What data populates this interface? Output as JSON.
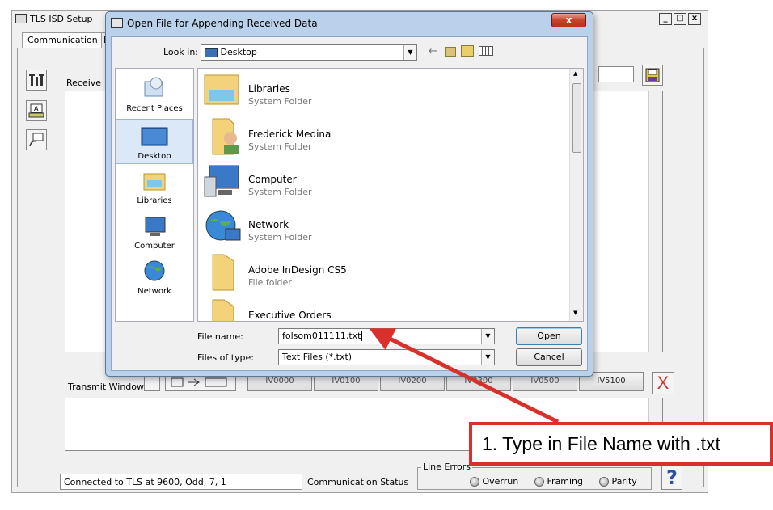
{
  "app": {
    "title": "TLS ISD Setup",
    "tab_label": "Communication",
    "tab_partial": "D",
    "received_label": "Receive",
    "transmit_label": "Transmit Window",
    "cmd_buttons": [
      "IV0000",
      "IV0100",
      "IV0200",
      "IV0300",
      "IV0500",
      "IV5100"
    ],
    "status_text": "Connected to TLS at 9600, Odd, 7, 1",
    "status_label": "Communication Status",
    "line_errors_label": "Line Errors",
    "errors": [
      "Overrun",
      "Framing",
      "Parity"
    ],
    "help_symbol": "?",
    "clear_symbol": "X",
    "minimize": "_",
    "maximize": "□",
    "close": "x"
  },
  "dialog": {
    "title": "Open File for Appending Received Data",
    "close_symbol": "x",
    "look_in_label": "Look in:",
    "look_in_value": "Desktop",
    "places": [
      "Recent Places",
      "Desktop",
      "Libraries",
      "Computer",
      "Network"
    ],
    "files": [
      {
        "name": "Libraries",
        "type": "System Folder"
      },
      {
        "name": "Frederick Medina",
        "type": "System Folder"
      },
      {
        "name": "Computer",
        "type": "System Folder"
      },
      {
        "name": "Network",
        "type": "System Folder"
      },
      {
        "name": "Adobe InDesign CS5",
        "type": "File folder"
      },
      {
        "name": "Executive Orders",
        "type": ""
      }
    ],
    "file_name_label": "File name:",
    "file_name_value": "folsom011111.txt",
    "file_type_label": "Files of type:",
    "file_type_value": "Text Files (*.txt)",
    "open_label": "Open",
    "cancel_label": "Cancel"
  },
  "annotation": {
    "text": "1.  Type in File Name with .txt",
    "color": "#d8312c"
  }
}
